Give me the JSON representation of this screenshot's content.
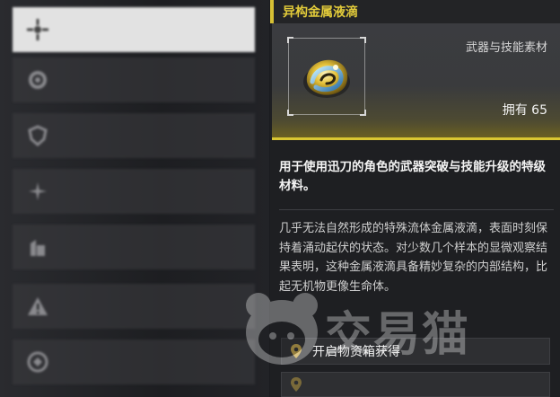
{
  "menu": {
    "items": [
      {
        "title": "",
        "subtitle": "",
        "active": true,
        "icon": "crosshair-icon"
      },
      {
        "title": "",
        "subtitle": "",
        "active": false,
        "icon": "gear-icon"
      },
      {
        "title": "",
        "subtitle": "",
        "active": false,
        "icon": "shield-icon"
      },
      {
        "title": "",
        "subtitle": "",
        "active": false,
        "icon": "compass-icon"
      },
      {
        "title": "",
        "subtitle": "",
        "active": false,
        "icon": "building-icon"
      },
      {
        "title": "",
        "subtitle": "",
        "active": false,
        "icon": "warning-icon"
      },
      {
        "title": "",
        "subtitle": "",
        "active": false,
        "icon": "emblem-icon"
      }
    ]
  },
  "item": {
    "name": "异构金属液滴",
    "category": "武器与技能素材",
    "owned": "拥有 65",
    "summary": "用于使用迅刀的角色的武器突破与技能升级的特级材料。",
    "description": "几乎无法自然形成的特殊流体金属液滴，表面时刻保持着涌动起伏的状态。对少数几个样本的显微观察结果表明，这种金属液滴具备精妙复杂的内部结构，比起无机物更像生命体。",
    "icon": "metal-droplet-icon",
    "sources": [
      {
        "label": "开启物资箱获得",
        "icon": "location-pin-icon"
      },
      {
        "label": "",
        "icon": "location-pin-icon"
      }
    ]
  },
  "watermark": {
    "text": "交易猫"
  },
  "colors": {
    "accent": "#d9c632",
    "title": "#e2cb3a",
    "panel": "#1e1f22"
  }
}
